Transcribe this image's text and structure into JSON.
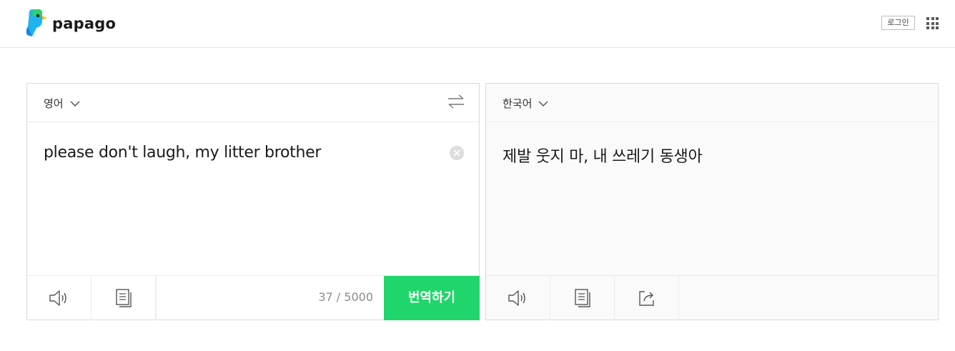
{
  "header": {
    "logo_text": "papago",
    "login_label": "로그인"
  },
  "source": {
    "language": "영어",
    "text": "please don't laugh, my litter brother",
    "char_count": "37 / 5000",
    "translate_label": "번역하기"
  },
  "target": {
    "language": "한국어",
    "text": "제발 웃지 마, 내 쓰레기 동생아"
  },
  "colors": {
    "translate_button": "#20d56b",
    "target_panel_bg": "#fafafa"
  },
  "icons": {
    "logo": "papago-parrot-icon",
    "apps": "apps-grid-icon",
    "swap": "swap-arrows-icon",
    "clear": "clear-circle-icon",
    "speaker": "speaker-icon",
    "copy": "copy-icon",
    "share": "share-icon"
  }
}
